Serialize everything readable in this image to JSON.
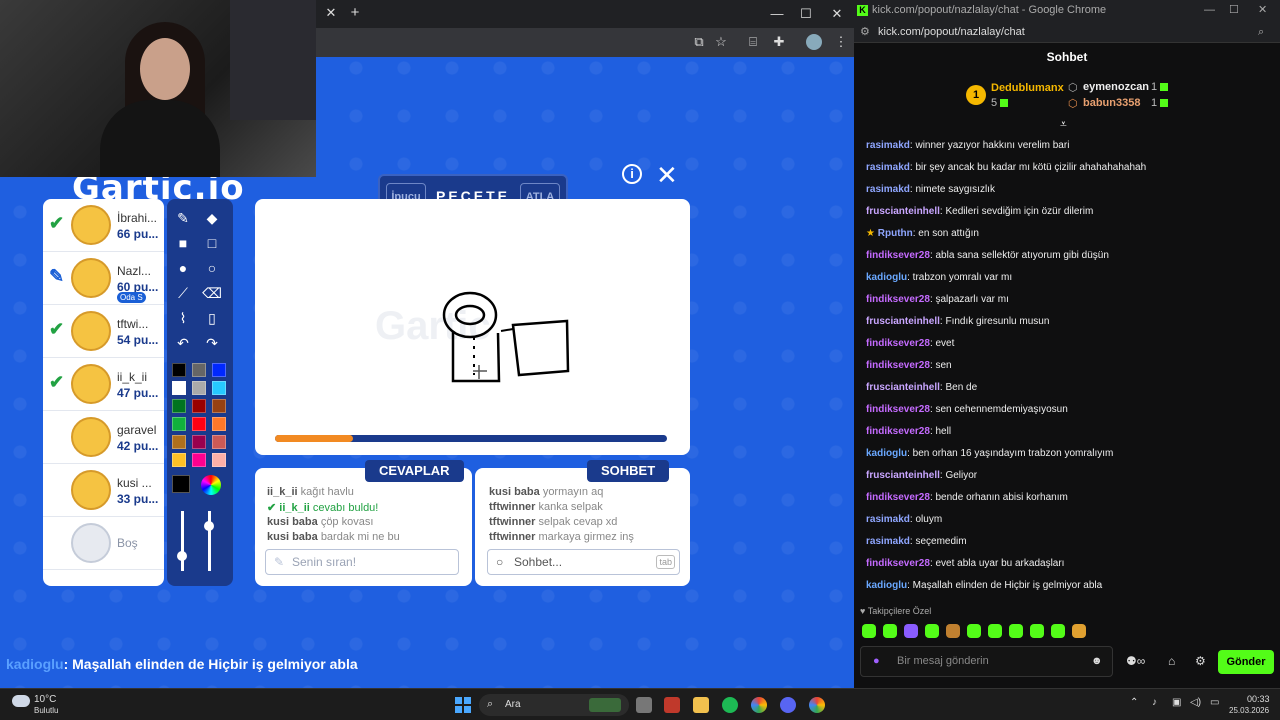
{
  "browser": {
    "url": "kick.com/popout/nazlalay/chat",
    "window_title": "kick.com/popout/nazlalay/chat - Google Chrome"
  },
  "game": {
    "logo": "Gartic.io",
    "hint_label": "İpucu",
    "word": "PEÇETE",
    "skip_label": "ATLA",
    "progress": 0.2,
    "players": [
      {
        "name": "İbrahi...",
        "score": "66 pu...",
        "state": "guessed"
      },
      {
        "name": "Nazl...",
        "score": "60 pu...",
        "state": "drawing",
        "badge": "Oda S"
      },
      {
        "name": "tftwi...",
        "score": "54 pu...",
        "state": "guessed"
      },
      {
        "name": "ii_k_ii",
        "score": "47 pu...",
        "state": "guessed"
      },
      {
        "name": "garavel",
        "score": "42 pu...",
        "state": "none"
      },
      {
        "name": "kusi ...",
        "score": "33 pu...",
        "state": "none"
      },
      {
        "name": "Boş",
        "score": "",
        "state": "empty"
      }
    ],
    "answers_title": "CEVAPLAR",
    "answers": [
      {
        "user": "ii_k_ii",
        "text": "kağıt havlu"
      },
      {
        "user": "ii_k_ii",
        "text": "cevabı buldu!",
        "found": true
      },
      {
        "user": "kusi baba",
        "text": "çöp kovası"
      },
      {
        "user": "kusi baba",
        "text": "bardak mi ne bu"
      }
    ],
    "answers_placeholder": "Senin sıran!",
    "chat_title": "SOHBET",
    "chat": [
      {
        "user": "kusi baba",
        "text": "yormayın aq"
      },
      {
        "user": "tftwinner",
        "text": "kanka selpak"
      },
      {
        "user": "tftwinner",
        "text": "selpak cevap xd"
      },
      {
        "user": "tftwinner",
        "text": "markaya girmez inş"
      }
    ],
    "chat_placeholder": "Sohbet...",
    "chat_tab_hint": "tab"
  },
  "overlay": {
    "user": "kadioglu",
    "text": ": Maşallah elinden de Hiçbir iş gelmiyor abla"
  },
  "kick": {
    "header": "Sohbet",
    "leaderboard": {
      "first": {
        "rank": "1",
        "name": "Dedublumanx",
        "count": "5"
      },
      "second": {
        "name": "eymenozcan",
        "count": "1"
      },
      "third": {
        "name": "babun3358",
        "count": "1"
      }
    },
    "messages": [
      {
        "user": "rasimakd",
        "text": ": winner yazıyor hakkını verelim bari",
        "color": "#8fa6ff"
      },
      {
        "user": "rasimakd",
        "text": ": bir şey ancak bu kadar mı kötü çizilir ahahahahahah",
        "color": "#8fa6ff"
      },
      {
        "user": "rasimakd",
        "text": ": nimete saygısızlık",
        "color": "#8fa6ff"
      },
      {
        "user": "frusciantеinhell",
        "text": ": Kedileri sevdiğim için özür dilerim",
        "color": "#c9a6ff"
      },
      {
        "user": "Rputhn",
        "text": ": en son attığın",
        "color": "#8fa6ff"
      },
      {
        "user": "findiksever28",
        "text": ": abla sana sellektör atıyorum gibi düşün",
        "color": "#c56bff"
      },
      {
        "user": "kadioglu",
        "text": ": trabzon yomralı var mı",
        "color": "#6aa8ff"
      },
      {
        "user": "findiksever28",
        "text": ": şalpazarlı var mı",
        "color": "#c56bff"
      },
      {
        "user": "frusciantеinhell",
        "text": ": Fındık giresunlu musun",
        "color": "#c9a6ff"
      },
      {
        "user": "findiksever28",
        "text": ": evet",
        "color": "#c56bff"
      },
      {
        "user": "findiksever28",
        "text": ": sen",
        "color": "#c56bff"
      },
      {
        "user": "frusciantеinhell",
        "text": ": Ben de",
        "color": "#c9a6ff"
      },
      {
        "user": "findiksever28",
        "text": ": sen cehennemdemiyaşıyosun",
        "color": "#c56bff"
      },
      {
        "user": "findiksever28",
        "text": ": hell",
        "color": "#c56bff"
      },
      {
        "user": "kadioglu",
        "text": ": ben orhan 16 yaşındayım trabzon yomralıyım",
        "color": "#6aa8ff"
      },
      {
        "user": "frusciantеinhell",
        "text": ": Geliyor",
        "color": "#c9a6ff"
      },
      {
        "user": "findiksever28",
        "text": ": bende orhanın abisi korhanım",
        "color": "#c56bff"
      },
      {
        "user": "rasimakd",
        "text": ": oluym",
        "color": "#8fa6ff"
      },
      {
        "user": "rasimakd",
        "text": ": seçemedim",
        "color": "#8fa6ff"
      },
      {
        "user": "findiksever28",
        "text": ": evet abla uyar bu arkadaşları",
        "color": "#c56bff"
      },
      {
        "user": "kadioglu",
        "text": ": Maşallah elinden de Hiçbir iş gelmiyor abla",
        "color": "#6aa8ff"
      }
    ],
    "followers_only": "Takipçilere Özel",
    "input_placeholder": "Bir mesaj gönderin",
    "send": "Gönder"
  },
  "taskbar": {
    "weather_temp": "10°C",
    "weather_desc": "Bulutlu",
    "search": "Ara",
    "time": "00:33",
    "date": "25.03.2026"
  }
}
